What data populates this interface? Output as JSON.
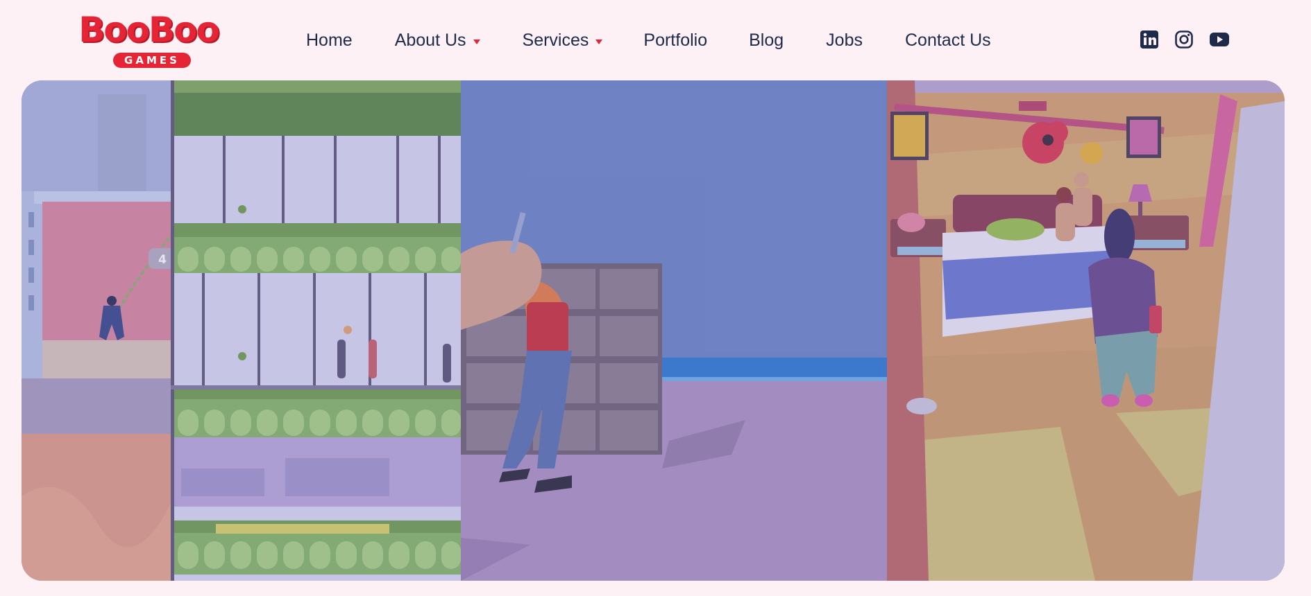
{
  "brand": {
    "logo_word": "BooBoo",
    "logo_sub": "GAMES",
    "colors": {
      "brand_red": "#e52535",
      "text_navy": "#1e2a4a",
      "background": "#fdf1f6"
    }
  },
  "nav": {
    "items": [
      {
        "label": "Home",
        "has_dropdown": false
      },
      {
        "label": "About Us",
        "has_dropdown": true
      },
      {
        "label": "Services",
        "has_dropdown": true
      },
      {
        "label": "Portfolio",
        "has_dropdown": false
      },
      {
        "label": "Blog",
        "has_dropdown": false
      },
      {
        "label": "Jobs",
        "has_dropdown": false
      },
      {
        "label": "Contact Us",
        "has_dropdown": false
      }
    ]
  },
  "social": [
    {
      "icon": "linkedin-icon"
    },
    {
      "icon": "instagram-icon"
    },
    {
      "icon": "youtube-icon"
    }
  ],
  "hero": {
    "level_badge": "4",
    "panels": [
      {
        "icon": "rope-swing-tower-game-scene"
      },
      {
        "icon": "knife-fighter-game-scene"
      },
      {
        "icon": "bedroom-couple-game-scene"
      }
    ]
  }
}
